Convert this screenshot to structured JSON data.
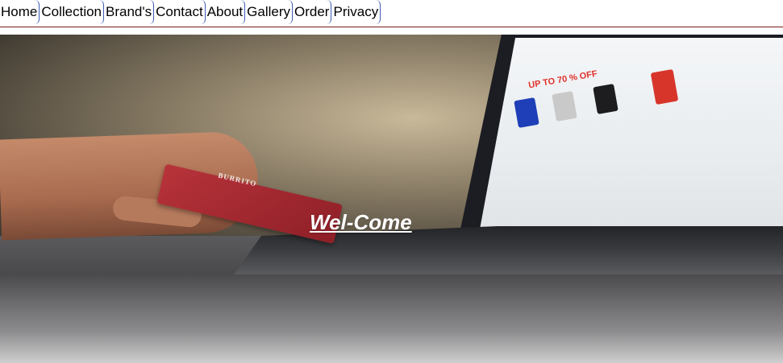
{
  "nav": {
    "items": [
      {
        "label": "Home"
      },
      {
        "label": "Collection"
      },
      {
        "label": "Brand's"
      },
      {
        "label": "Contact"
      },
      {
        "label": "About"
      },
      {
        "label": "Gallery"
      },
      {
        "label": "Order"
      },
      {
        "label": "Privacy"
      }
    ]
  },
  "hero": {
    "welcome_text": "Wel-Come",
    "promo_text": "UP TO 70 % OFF",
    "card_text": "BURRITO"
  },
  "colors": {
    "nav_border": "#3b5bb5",
    "nav_rule": "#7a1a1a",
    "card": "#a52a31",
    "promo": "#e0322b"
  }
}
